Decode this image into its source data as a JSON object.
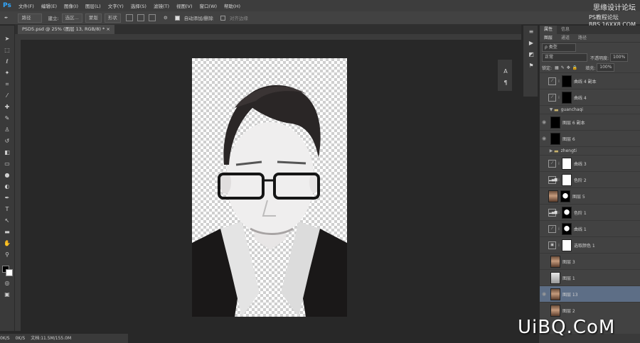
{
  "app": {
    "logo": "Ps"
  },
  "menu": [
    "文件(F)",
    "编辑(E)",
    "图像(I)",
    "图层(L)",
    "文字(Y)",
    "选择(S)",
    "滤镜(T)",
    "视图(V)",
    "窗口(W)",
    "帮助(H)"
  ],
  "site": {
    "name": "思缘设计论坛",
    "url_top": "PS教程论坛",
    "url_bottom": "BBS.16XX8.COM"
  },
  "options": {
    "path_mode": "路径",
    "make_label": "建立:",
    "selection_btn": "选区...",
    "mask_btn": "蒙版",
    "shape_btn": "形状",
    "auto_add_delete": "自动添加/删除",
    "align_edges": "对齐边缘"
  },
  "document": {
    "tab_title": "PSD5.psd @ 25% (图层 13, RGB/8) *",
    "close_glyph": "×"
  },
  "status": {
    "zoom": "0K/S",
    "zoom2": "0K/S",
    "doc_size": "文档:11.5M/155.0M"
  },
  "layers_panel": {
    "tabs": [
      "图层",
      "通道",
      "路径"
    ],
    "top_tabs": [
      "属性",
      "信息"
    ],
    "filter_kind": "ρ 类型",
    "blend_mode": "正常",
    "opacity_label": "不透明度:",
    "opacity_value": "100%",
    "lock_label": "锁定:",
    "fill_label": "填充:",
    "fill_value": "100%",
    "layers": [
      {
        "name": "曲线 4 副本",
        "type": "adjust",
        "thumb": "black"
      },
      {
        "name": "曲线 4",
        "type": "adjust",
        "thumb": "black"
      },
      {
        "name": "guanchaqi",
        "type": "group"
      },
      {
        "name": "图层 6 副本",
        "type": "plain",
        "thumb": "black"
      },
      {
        "name": "图层 6",
        "type": "plain",
        "thumb": "black"
      },
      {
        "name": "zhengti",
        "type": "group"
      },
      {
        "name": "曲线 3",
        "type": "adjust",
        "thumb": "white"
      },
      {
        "name": "色阶 2",
        "type": "levels",
        "thumb": "white"
      },
      {
        "name": "图层 5",
        "type": "photo-mask",
        "thumb": "mask"
      },
      {
        "name": "色阶 1",
        "type": "levels",
        "thumb": "mask"
      },
      {
        "name": "曲线 1",
        "type": "adjust",
        "thumb": "mask"
      },
      {
        "name": "选取颜色 1",
        "type": "selective",
        "thumb": "white"
      },
      {
        "name": "图层 3",
        "type": "photo",
        "thumb": "photo"
      },
      {
        "name": "图层 1",
        "type": "photo",
        "thumb": "gray"
      },
      {
        "name": "图层 13",
        "type": "photo",
        "thumb": "photo",
        "selected": true
      },
      {
        "name": "图层 2",
        "type": "photo",
        "thumb": "photo"
      }
    ]
  },
  "watermark": "UiBQ.CoM"
}
